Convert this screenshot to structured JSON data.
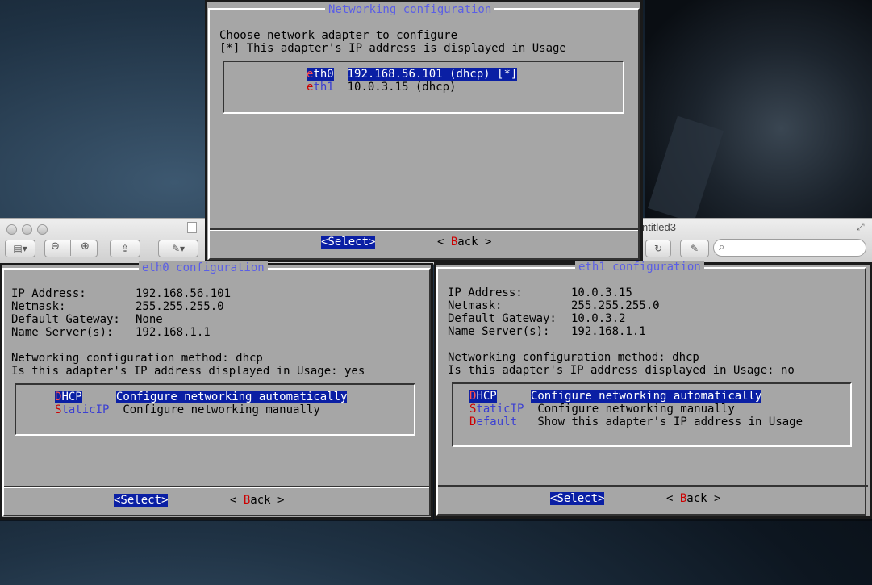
{
  "mac_window": {
    "title": "ntitled3"
  },
  "top_dialog": {
    "title": "Networking configuration",
    "prompt": "Choose network adapter to configure",
    "note": "[*] This adapter's IP address is displayed in Usage",
    "items": [
      {
        "tag_hot": "e",
        "tag_rest": "th0",
        "desc": "192.168.56.101 (dhcp) [*]",
        "selected": true
      },
      {
        "tag_hot": "e",
        "tag_rest": "th1",
        "desc": "10.0.3.15 (dhcp)",
        "selected": false
      }
    ],
    "select_label": "<Select>",
    "back_label": "< Back >"
  },
  "eth0_dialog": {
    "title": "eth0 configuration",
    "fields": [
      {
        "label": "IP Address:",
        "value": "192.168.56.101"
      },
      {
        "label": "Netmask:",
        "value": "255.255.255.0"
      },
      {
        "label": "Default Gateway:",
        "value": "None"
      },
      {
        "label": "Name Server(s):",
        "value": "192.168.1.1"
      }
    ],
    "method": "Networking configuration method: dhcp",
    "usage": "Is this adapter's IP address displayed in Usage: yes",
    "items": [
      {
        "tag_hot": "D",
        "tag_rest": "HCP",
        "desc": "Configure networking automatically",
        "selected": true
      },
      {
        "tag_hot": "S",
        "tag_rest": "taticIP",
        "desc": "Configure networking manually",
        "selected": false
      }
    ],
    "select_label": "<Select>",
    "back_label": "< Back >"
  },
  "eth1_dialog": {
    "title": "eth1 configuration",
    "fields": [
      {
        "label": "IP Address:",
        "value": "10.0.3.15"
      },
      {
        "label": "Netmask:",
        "value": "255.255.255.0"
      },
      {
        "label": "Default Gateway:",
        "value": "10.0.3.2"
      },
      {
        "label": "Name Server(s):",
        "value": "192.168.1.1"
      }
    ],
    "method": "Networking configuration method: dhcp",
    "usage": "Is this adapter's IP address displayed in Usage: no",
    "items": [
      {
        "tag_hot": "D",
        "tag_rest": "HCP",
        "desc": "Configure networking automatically",
        "selected": true
      },
      {
        "tag_hot": "S",
        "tag_rest": "taticIP",
        "desc": "Configure networking manually",
        "selected": false
      },
      {
        "tag_hot": "D",
        "tag_rest": "efault",
        "desc": "Show this adapter's IP address in Usage",
        "selected": false
      }
    ],
    "select_label": "<Select>",
    "back_label": "< Back >"
  },
  "colors": {
    "dialog_bg": "#a6a6a6",
    "title": "#5a5ee6",
    "selection_bg": "#0a1fa4",
    "hotkey": "#cc0000"
  }
}
